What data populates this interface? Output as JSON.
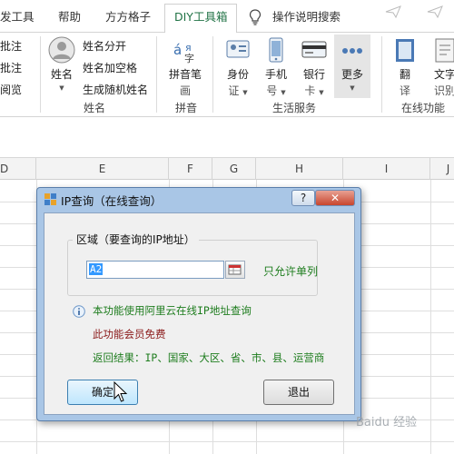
{
  "tabs": [
    {
      "label": "发工具",
      "active": false
    },
    {
      "label": "帮助",
      "active": false
    },
    {
      "label": "方方格子",
      "active": false
    },
    {
      "label": "DIY工具箱",
      "active": true
    },
    {
      "label": "操作说明搜索",
      "active": false
    }
  ],
  "ribbon": {
    "left_items": [
      "批注",
      "批注",
      "阅览"
    ],
    "name_group": {
      "big_button": "姓名",
      "items": [
        "姓名分开",
        "姓名加空格",
        "生成随机姓名"
      ],
      "label": "姓名"
    },
    "pinyin_group": {
      "button_line1": "拼音笔",
      "button_line2": "画",
      "label": "拼音"
    },
    "life_group": {
      "buttons": [
        {
          "line1": "身份",
          "line2": "证"
        },
        {
          "line1": "手机",
          "line2": "号"
        },
        {
          "line1": "银行",
          "line2": "卡"
        },
        {
          "line1": "更多",
          "line2": ""
        }
      ],
      "label": "生活服务"
    },
    "online_group": {
      "buttons": [
        {
          "line1": "翻",
          "line2": "译"
        },
        {
          "line1": "文字",
          "line2": "识别"
        }
      ],
      "label": "在线功能"
    }
  },
  "sheet": {
    "columns": [
      "D",
      "E",
      "F",
      "G",
      "H",
      "I",
      "J"
    ]
  },
  "dialog": {
    "title": "IP查询（在线查询）",
    "help_label": "?",
    "close_label": "✕",
    "group_label": "区域（要查询的IP地址）",
    "range_value": "A2",
    "single_column_note": "只允许单列",
    "info_line1": "本功能使用阿里云在线IP地址查询",
    "info_line2": "此功能会员免费",
    "info_line3": "返回结果：IP、国家、大区、省、市、县、运营商",
    "ok_label": "确定",
    "exit_label": "退出"
  },
  "watermark": "Baidu 经验",
  "colors": {
    "accent_green": "#217346",
    "note_green": "#1e7d1e",
    "note_red": "#8b1a1a",
    "dialog_frame": "#a9c6e6",
    "close_red": "#c8452d"
  }
}
